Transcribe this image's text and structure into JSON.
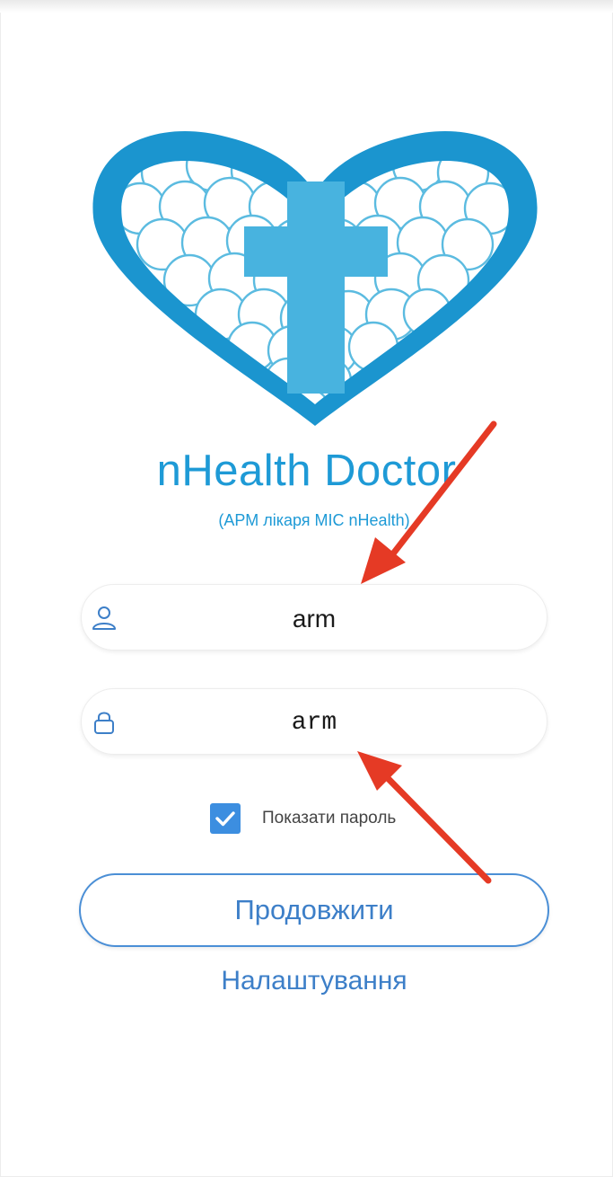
{
  "app": {
    "title": "nHealth Doctor",
    "subtitle": "(АРМ лікаря МІС nHealth)"
  },
  "login": {
    "icon": "user-icon",
    "value": "arm"
  },
  "password": {
    "icon": "lock-icon",
    "value": "arm"
  },
  "show_password": {
    "label": "Показати пароль",
    "checked": true
  },
  "actions": {
    "continue_label": "Продовжити",
    "settings_label": "Налаштування"
  },
  "colors": {
    "brand": "#1e9ad6",
    "accent": "#3d7fc8",
    "annotation_arrow": "#e53a25"
  }
}
